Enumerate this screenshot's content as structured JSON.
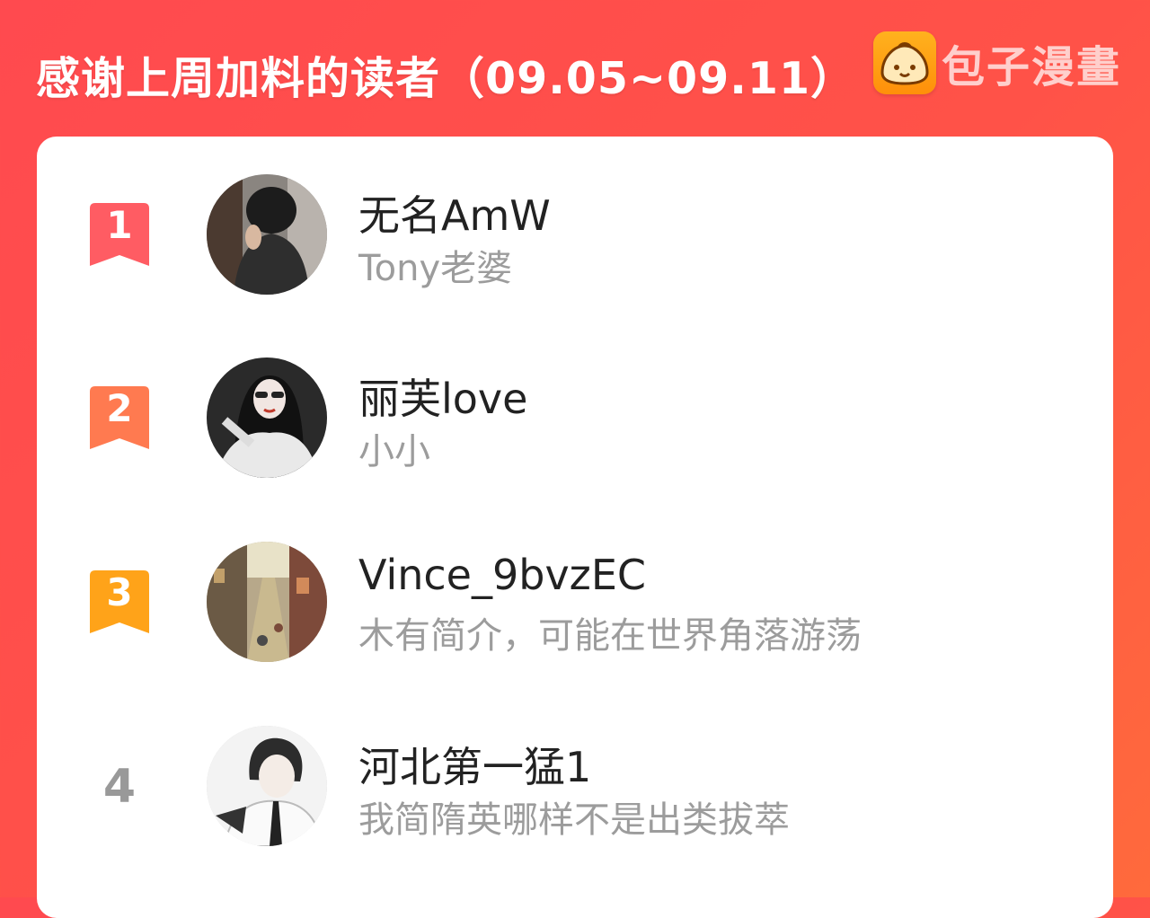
{
  "header": {
    "title": "感谢上周加料的读者（09.05~09.11）",
    "brand_name": "包子漫畫",
    "logo_icon": "baozi-bun-icon"
  },
  "colors": {
    "background": "#ff4d4a",
    "rank1": "#ff5c63",
    "rank2": "#ff7a50",
    "rank3": "#ffa319",
    "rank_plain": "#999999",
    "name_text": "#222222",
    "bio_text": "#9c9c9c"
  },
  "readers": [
    {
      "rank": "1",
      "name": "无名AmW",
      "bio": "Tony老婆",
      "avatar": "avatar-photo-icon"
    },
    {
      "rank": "2",
      "name": "丽芙love",
      "bio": "小小",
      "avatar": "avatar-illustration-icon"
    },
    {
      "rank": "3",
      "name": "Vince_9bvzEC",
      "bio": "木有简介，可能在世界角落游荡",
      "avatar": "avatar-street-icon"
    },
    {
      "rank": "4",
      "name": "河北第一猛1",
      "bio": "我简隋英哪样不是出类拔萃",
      "avatar": "avatar-anime-icon"
    }
  ]
}
